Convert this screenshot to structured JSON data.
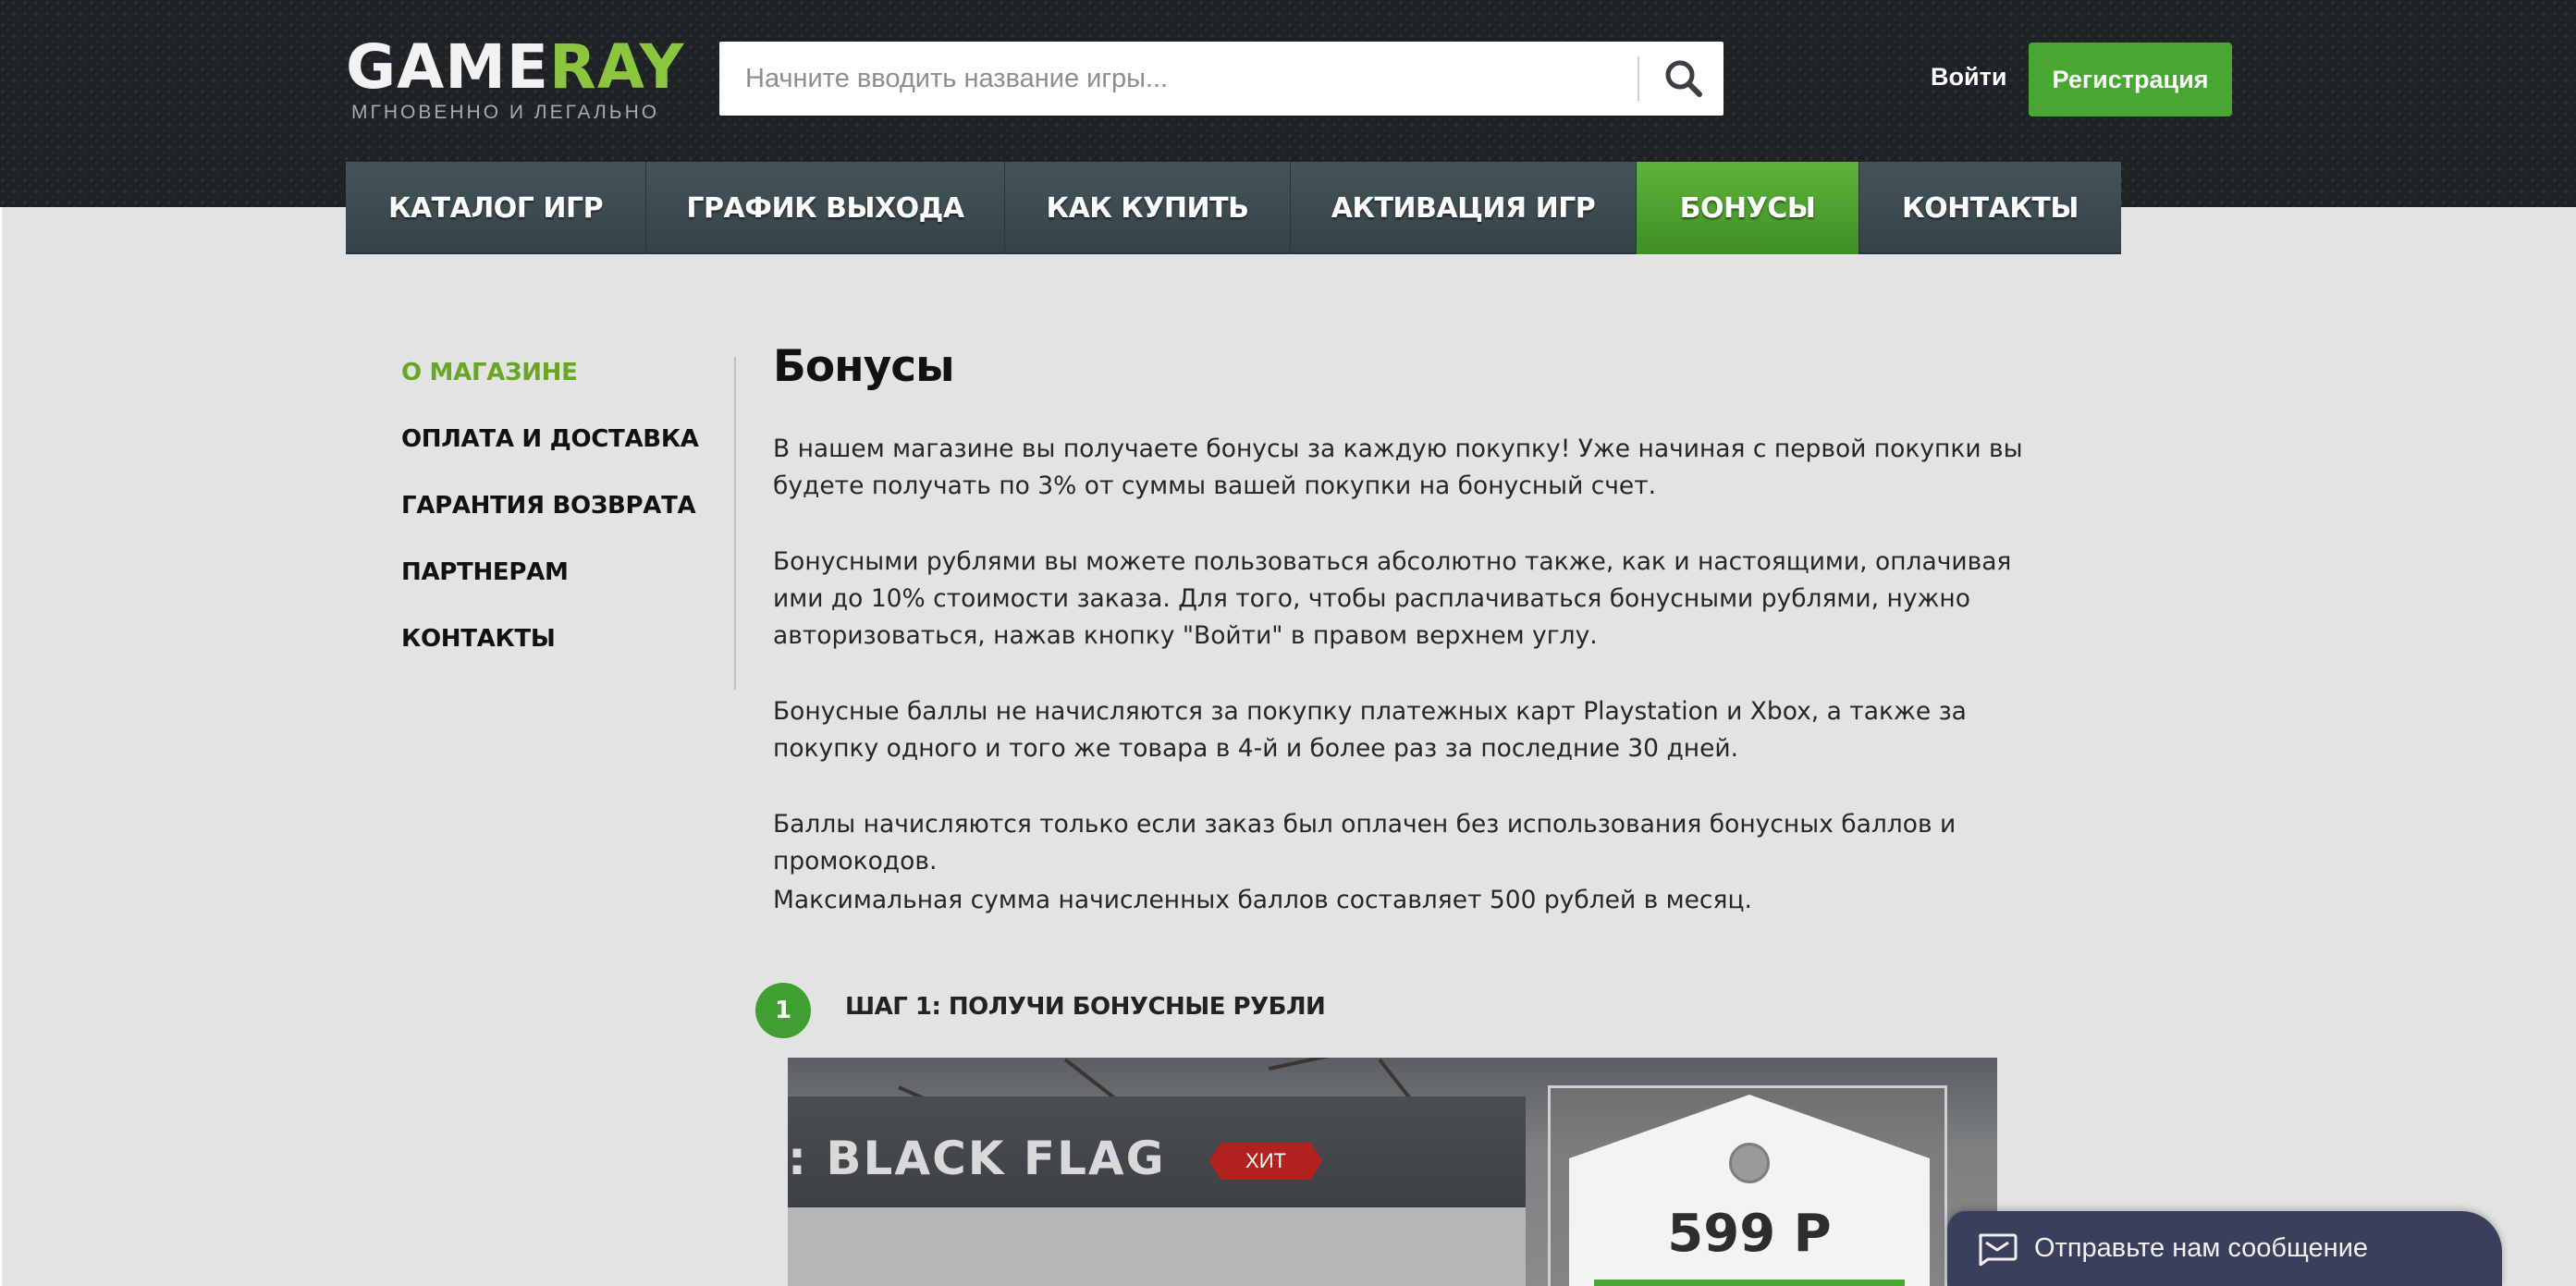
{
  "header": {
    "logo": {
      "word_part1": "GAME",
      "word_part2": "RAY",
      "tagline": "МГНОВЕННО И ЛЕГАЛЬНО"
    },
    "search": {
      "placeholder": "Начните вводить название игры...",
      "value": "",
      "icon": "search-icon"
    },
    "login_label": "Войти",
    "register_label": "Регистрация"
  },
  "nav": {
    "items": [
      {
        "label": "КАТАЛОГ ИГР"
      },
      {
        "label": "ГРАФИК ВЫХОДА"
      },
      {
        "label": "КАК КУПИТЬ"
      },
      {
        "label": "АКТИВАЦИЯ ИГР"
      },
      {
        "label": "БОНУСЫ",
        "active": true
      },
      {
        "label": "КОНТАКТЫ"
      }
    ]
  },
  "sidebar": {
    "items": [
      {
        "label": "О МАГАЗИНЕ",
        "active": true
      },
      {
        "label": "ОПЛАТА И ДОСТАВКА"
      },
      {
        "label": "ГАРАНТИЯ ВОЗВРАТА"
      },
      {
        "label": "ПАРТНЕРАМ"
      },
      {
        "label": "КОНТАКТЫ"
      }
    ]
  },
  "content": {
    "title": "Бонусы",
    "paragraphs": [
      "В нашем магазине вы получаете бонусы за каждую покупку! Уже начиная с первой покупки вы будете получать по 3% от суммы вашей покупки на бонусный счет.",
      "Бонусными рублями вы можете пользоваться абсолютно также, как и настоящими, оплачивая ими до 10% стоимости заказа. Для того, чтобы расплачиваться бонусными рублями, нужно авторизоваться, нажав кнопку \"Войти\" в правом верхнем углу.",
      "Бонусные баллы не начисляются за покупку платежных карт Playstation и Xbox, а также за покупку одного и того же товара в 4-й и более раз за последние 30 дней.",
      "Баллы начисляются только если заказ был оплачен без использования бонусных баллов и промокодов.",
      "Максимальная сумма начисленных баллов составляет 500 рублей в месяц."
    ],
    "step": {
      "number": "1",
      "title": "ШАГ 1: ПОЛУЧИ БОНУСНЫЕ РУБЛИ"
    },
    "preview": {
      "game_title": ": BLACK FLAG",
      "badge": "ХИТ",
      "price": "599 Р"
    }
  },
  "chat": {
    "label": "Отправьте нам сообщение",
    "icon": "chat-icon"
  },
  "colors": {
    "accent_green": "#48a632",
    "sidebar_active": "#6aa626",
    "nav_bg": "#3b4a51",
    "header_bg": "#1f2224",
    "chat_bg": "#3a3f5c"
  }
}
